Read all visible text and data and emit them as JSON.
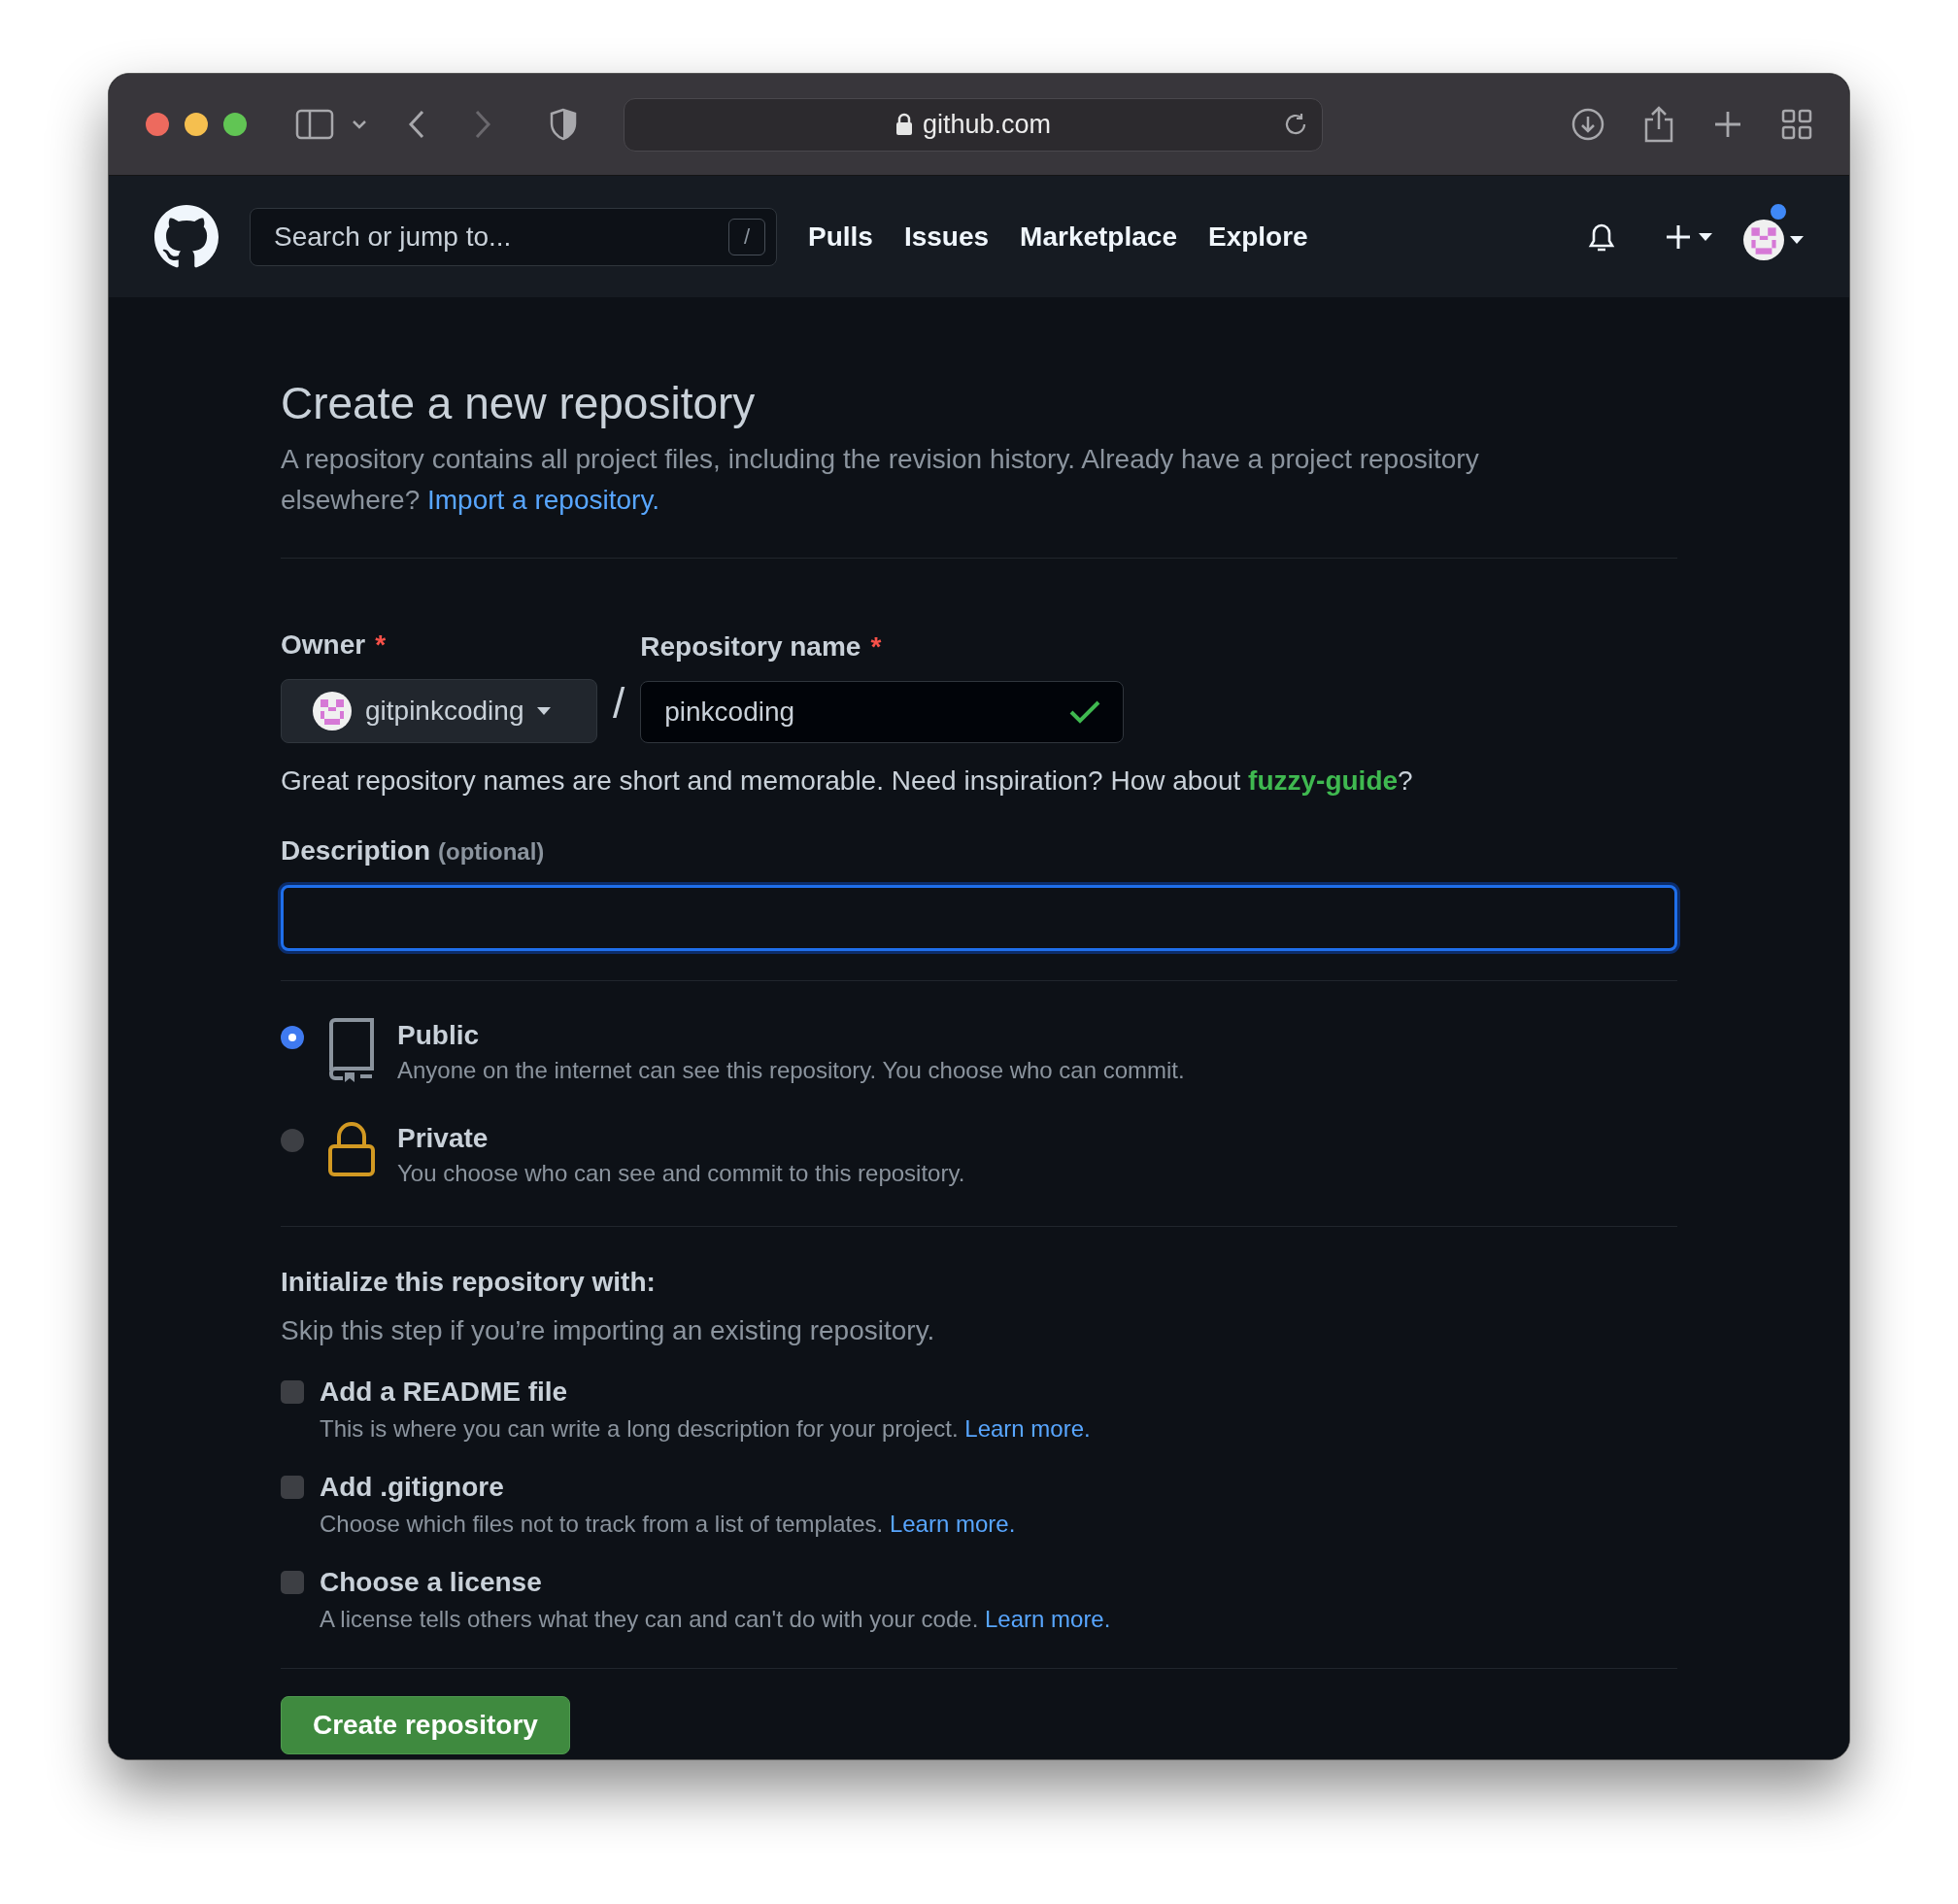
{
  "browser": {
    "url": "github.com"
  },
  "header": {
    "search": {
      "placeholder": "Search or jump to...",
      "shortcut": "/"
    },
    "nav": [
      "Pulls",
      "Issues",
      "Marketplace",
      "Explore"
    ],
    "notification_dot": true
  },
  "page": {
    "title": "Create a new repository",
    "intro": "A repository contains all project files, including the revision history. Already have a project repository elsewhere?",
    "intro_link": "Import a repository."
  },
  "owner": {
    "label": "Owner",
    "required_mark": "*",
    "value": "gitpinkcoding"
  },
  "separator": "/",
  "repo_name": {
    "label": "Repository name",
    "required_mark": "*",
    "value": "pinkcoding",
    "valid": true
  },
  "hint": {
    "text": "Great repository names are short and memorable. Need inspiration? How about",
    "suggestion": "fuzzy-guide",
    "end": "?"
  },
  "description": {
    "label": "Description",
    "optional": "(optional)",
    "focused": true
  },
  "visibility": [
    {
      "kind": "public",
      "title": "Public",
      "text": "Anyone on the internet can see this repository. You choose who can commit.",
      "selected": true
    },
    {
      "kind": "private",
      "title": "Private",
      "text": "You choose who can see and commit to this repository.",
      "selected": false
    }
  ],
  "init": {
    "title": "Initialize this repository with:",
    "subtitle": "Skip this step if you’re importing an existing repository.",
    "options": [
      {
        "title": "Add a README file",
        "text": "This is where you can write a long description for your project.",
        "link": "Learn more.",
        "checked": false
      },
      {
        "title": "Add .gitignore",
        "text": "Choose which files not to track from a list of templates.",
        "link": "Learn more.",
        "checked": false
      },
      {
        "title": "Choose a license",
        "text": "A license tells others what they can and can't do with your code.",
        "link": "Learn more.",
        "checked": false
      }
    ]
  },
  "submit": "Create repository"
}
